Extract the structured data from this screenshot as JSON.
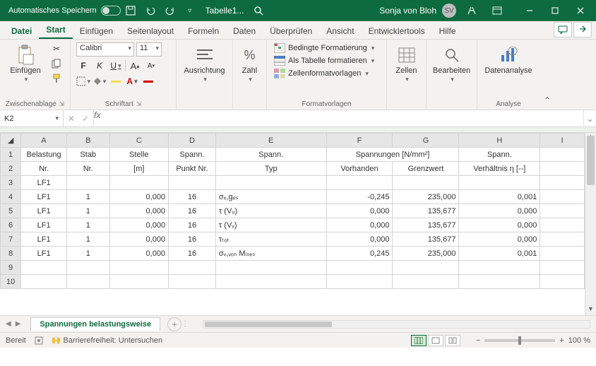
{
  "title": {
    "autosave": "Automatisches Speichern",
    "doc": "Tabelle1...",
    "user": "Sonja von Bloh",
    "initials": "SV"
  },
  "tabs": {
    "file": "Datei",
    "start": "Start",
    "insert": "Einfügen",
    "layout": "Seitenlayout",
    "formulas": "Formeln",
    "data": "Daten",
    "review": "Überprüfen",
    "view": "Ansicht",
    "dev": "Entwicklertools",
    "help": "Hilfe"
  },
  "ribbon": {
    "clipboard": {
      "paste": "Einfügen",
      "group": "Zwischenablage"
    },
    "font": {
      "name": "Calibri",
      "size": "11",
      "group": "Schriftart"
    },
    "align": {
      "label": "Ausrichtung"
    },
    "number": {
      "label": "Zahl"
    },
    "styles": {
      "cond": "Bedingte Formatierung",
      "table": "Als Tabelle formatieren",
      "cell": "Zellenformatvorlagen",
      "group": "Formatvorlagen"
    },
    "cells": {
      "label": "Zellen"
    },
    "editing": {
      "label": "Bearbeiten"
    },
    "analysis": {
      "label": "Datenanalyse",
      "group": "Analyse"
    }
  },
  "namebox": {
    "ref": "K2"
  },
  "columns": [
    "A",
    "B",
    "C",
    "D",
    "E",
    "F",
    "G",
    "H",
    "I"
  ],
  "headers1": {
    "A": "Belastung",
    "B": "Stab",
    "C": "Stelle",
    "D": "Spann.",
    "E": "Spann.",
    "FG": "Spannungen [N/mm²]",
    "H": "Spann.",
    "I": ""
  },
  "headers2": {
    "A": "Nr.",
    "B": "Nr.",
    "C": "[m]",
    "D": "Punkt Nr.",
    "E": "Typ",
    "F": "Vorhanden",
    "G": "Grenzwert",
    "H": "Verhältnis η [--]",
    "I": ""
  },
  "rows": [
    {
      "n": 3,
      "A": "LF1"
    },
    {
      "n": 4,
      "A": "LF1",
      "B": "1",
      "C": "0,000",
      "D": "16",
      "E": "σₓ,gₑₛ",
      "F": "-0,245",
      "G": "235,000",
      "H": "0,001"
    },
    {
      "n": 5,
      "A": "LF1",
      "B": "1",
      "C": "0,000",
      "D": "16",
      "E": "τ (Vᵤ)",
      "F": "0,000",
      "G": "135,677",
      "H": "0,000"
    },
    {
      "n": 6,
      "A": "LF1",
      "B": "1",
      "C": "0,000",
      "D": "16",
      "E": "τ (Vᵥ)",
      "F": "0,000",
      "G": "135,677",
      "H": "0,000"
    },
    {
      "n": 7,
      "A": "LF1",
      "B": "1",
      "C": "0,000",
      "D": "16",
      "E": "τₜₒₜ",
      "F": "0,000",
      "G": "135,677",
      "H": "0,000"
    },
    {
      "n": 8,
      "A": "LF1",
      "B": "1",
      "C": "0,000",
      "D": "16",
      "E": "σᵥ,ᵥₒₙ Mᵢₛₑₛ",
      "F": "0,245",
      "G": "235,000",
      "H": "0,001"
    },
    {
      "n": 9
    },
    {
      "n": 10
    }
  ],
  "sheet_tab": "Spannungen belastungsweise",
  "status": {
    "ready": "Bereit",
    "access": "Barrierefreiheit: Untersuchen",
    "zoom": "100 %"
  }
}
